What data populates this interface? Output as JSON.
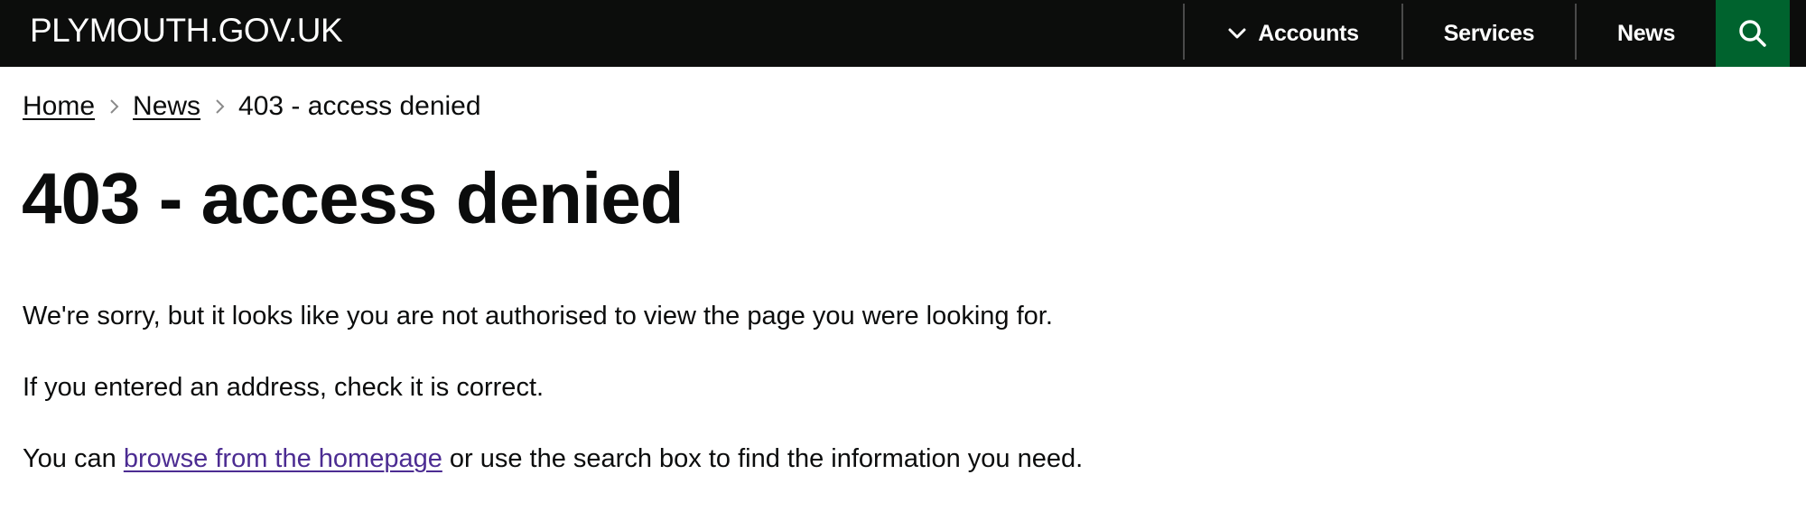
{
  "header": {
    "logo": "PLYMOUTH.GOV.UK",
    "nav": [
      {
        "label": "Accounts",
        "icon": "chevron-down-icon"
      },
      {
        "label": "Services"
      },
      {
        "label": "News"
      }
    ],
    "search_icon": "search-icon",
    "colors": {
      "background": "#0c0d0c",
      "search_button": "#00632e"
    }
  },
  "breadcrumb": {
    "items": [
      {
        "label": "Home"
      },
      {
        "label": "News"
      }
    ],
    "current": "403 - access denied",
    "separator_icon": "chevron-right-icon"
  },
  "main": {
    "title": "403 - access denied",
    "paragraph_1": "We're sorry, but it looks like you are not authorised to view the page you were looking for.",
    "paragraph_2": "If you entered an address, check it is correct.",
    "paragraph_3": {
      "before": "You can ",
      "link": "browse from the homepage",
      "after": " or use the search box to find the information you need."
    },
    "link_color": "#4c2c92"
  }
}
